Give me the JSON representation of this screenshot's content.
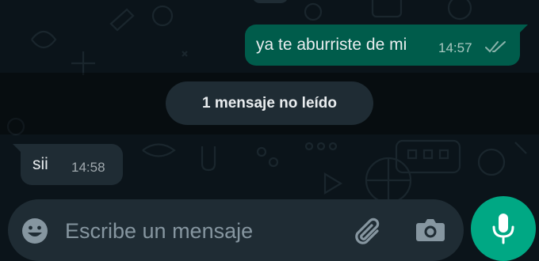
{
  "chat": {
    "outgoing": {
      "text": "ya te aburriste de mi",
      "time": "14:57",
      "status_icon": "double-check-icon"
    },
    "unread_banner": "1 mensaje no leído",
    "incoming": {
      "text": "sii",
      "time": "14:58"
    }
  },
  "composer": {
    "placeholder": "Escribe un mensaje",
    "icons": [
      "emoji-icon",
      "attach-icon",
      "camera-icon",
      "microphone-icon"
    ]
  },
  "colors": {
    "background": "#0b141a",
    "outgoing_bubble": "#005c4b",
    "incoming_bubble": "#1f2c34",
    "accent": "#00a884",
    "text": "#e9edef",
    "muted": "#8696a0"
  }
}
